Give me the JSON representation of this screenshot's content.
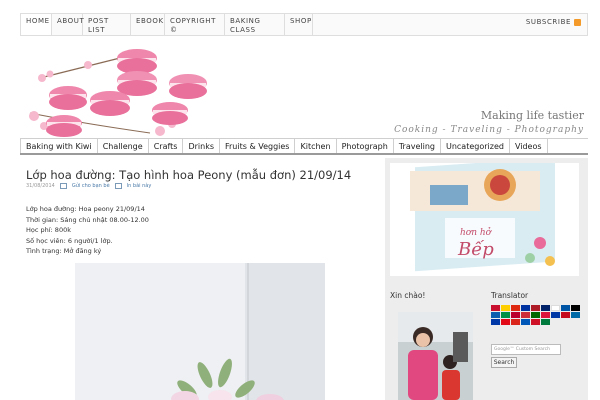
{
  "top_nav": {
    "items": [
      {
        "label": "HOME"
      },
      {
        "label": "ABOUT"
      },
      {
        "label": "POST LIST"
      },
      {
        "label": "EBOOK"
      },
      {
        "label": "COPYRIGHT ©"
      },
      {
        "label": "BAKING CLASS"
      },
      {
        "label": "SHOP"
      }
    ],
    "subscribe": "SUBSCRIBE"
  },
  "header": {
    "tagline": "Making life tastier",
    "subtagline": "Cooking - Traveling - Photography"
  },
  "category_nav": {
    "items": [
      "Baking with Kiwi",
      "Challenge",
      "Crafts",
      "Drinks",
      "Fruits & Veggies",
      "Kitchen",
      "Photograph",
      "Traveling",
      "Uncategorized",
      "Videos"
    ]
  },
  "post": {
    "title": "Lớp hoa đường: Tạo hình hoa Peony (mẫu đơn) 21/09/14",
    "date": "31/08/2014",
    "send_label": "Gửi cho bạn bè",
    "print_label": "In bài này",
    "lines": [
      "Lớp hoa đường: Hoa peony 21/09/14",
      "Thời gian: Sáng chủ nhật 08.00-12.00",
      "Học phí: 800k",
      "Số học viên: 6 người/1 lớp.",
      "Tình trạng: Mở đăng ký"
    ]
  },
  "sidebar": {
    "xinchao_title": "Xin chào!",
    "translator_title": "Translator",
    "search_placeholder": "Google™ Custom Search",
    "search_button": "Search"
  },
  "colors": {
    "accent_pink": "#e86b9a",
    "rss_orange": "#f39a2b",
    "link_blue": "#4a7aa8"
  }
}
